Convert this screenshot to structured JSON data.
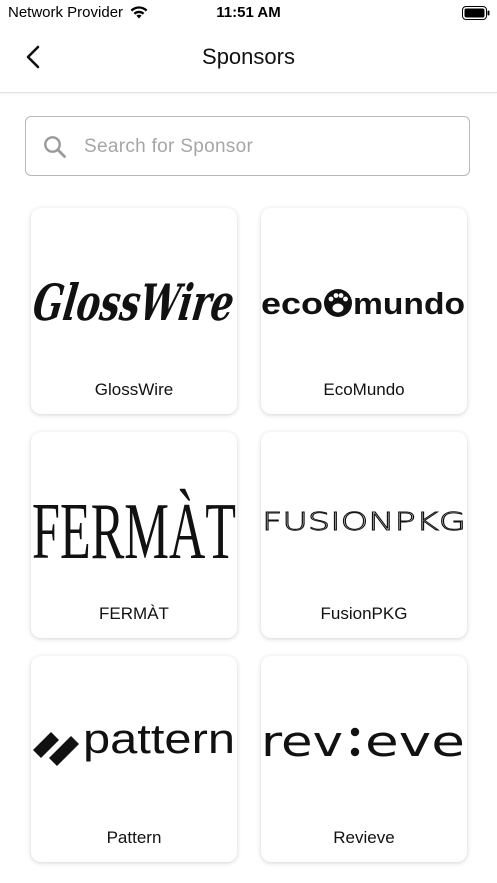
{
  "status_bar": {
    "carrier": "Network Provider",
    "time": "11:51 AM"
  },
  "nav": {
    "title": "Sponsors"
  },
  "search": {
    "placeholder": "Search for Sponsor",
    "value": ""
  },
  "sponsors": [
    {
      "name": "GlossWire",
      "logo_text": "GlossWire"
    },
    {
      "name": "EcoMundo",
      "logo_text_left": "eco",
      "logo_text_right": "mundo"
    },
    {
      "name": "FERMÀT",
      "logo_text": "FERMÀT"
    },
    {
      "name": "FusionPKG",
      "logo_text": "FUSIONPKG"
    },
    {
      "name": "Pattern",
      "logo_text": "pattern"
    },
    {
      "name": "Revieve",
      "logo_text_left": "rev",
      "logo_text_right": "eve"
    }
  ]
}
